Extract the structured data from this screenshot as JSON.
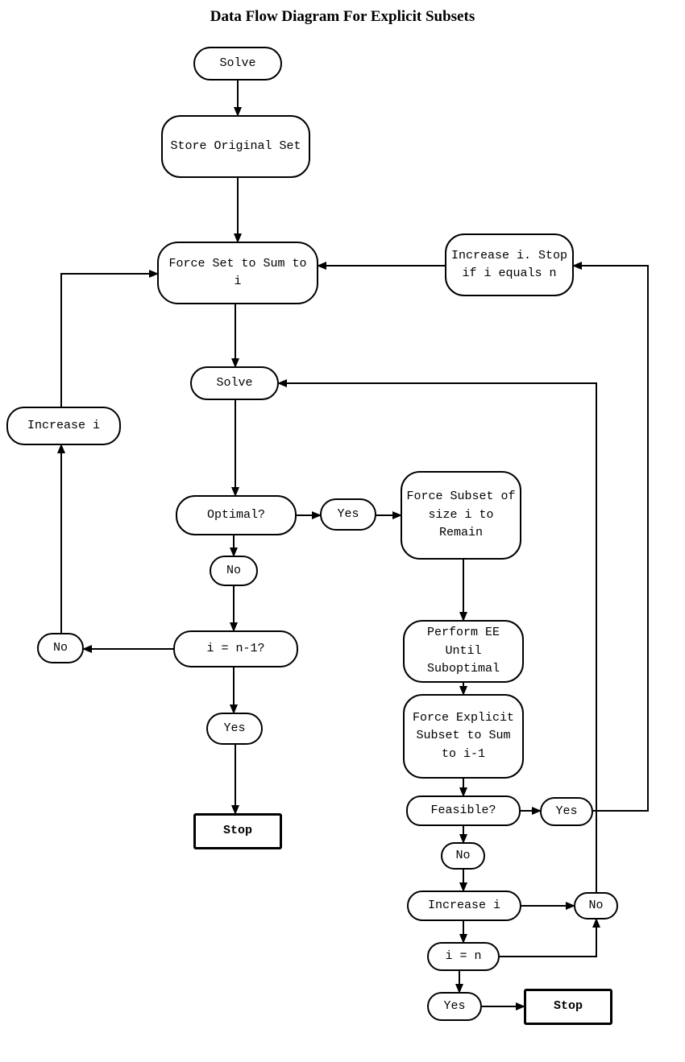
{
  "title": "Data Flow Diagram For Explicit Subsets",
  "nodes": {
    "solve1": "Solve",
    "store": "Store\nOriginal Set",
    "forceSet": "Force Set to\nSum to i",
    "increaseIStop": "Increase i.\nStop if i\nequals n",
    "solve2": "Solve",
    "increaseIleft": "Increase i",
    "optimal": "Optimal?",
    "yes1": "Yes",
    "forceSubset": "Force\nSubset of\nsize i to\nRemain",
    "no1": "No",
    "iN1": "i = n-1?",
    "noLeft": "No",
    "yesLeftBranch": "Yes",
    "performEE": "Perform EE\nUntil\nSuboptimal",
    "forceExplicit": "Force\nExplicit\nSubset to\nSum to i-1",
    "feasible": "Feasible?",
    "yesFeasible": "Yes",
    "stop1": "Stop",
    "noFeasible": "No",
    "increaseI2": "Increase i",
    "noRight": "No",
    "iEqN": "i = n",
    "yes2": "Yes",
    "stop2": "Stop"
  }
}
